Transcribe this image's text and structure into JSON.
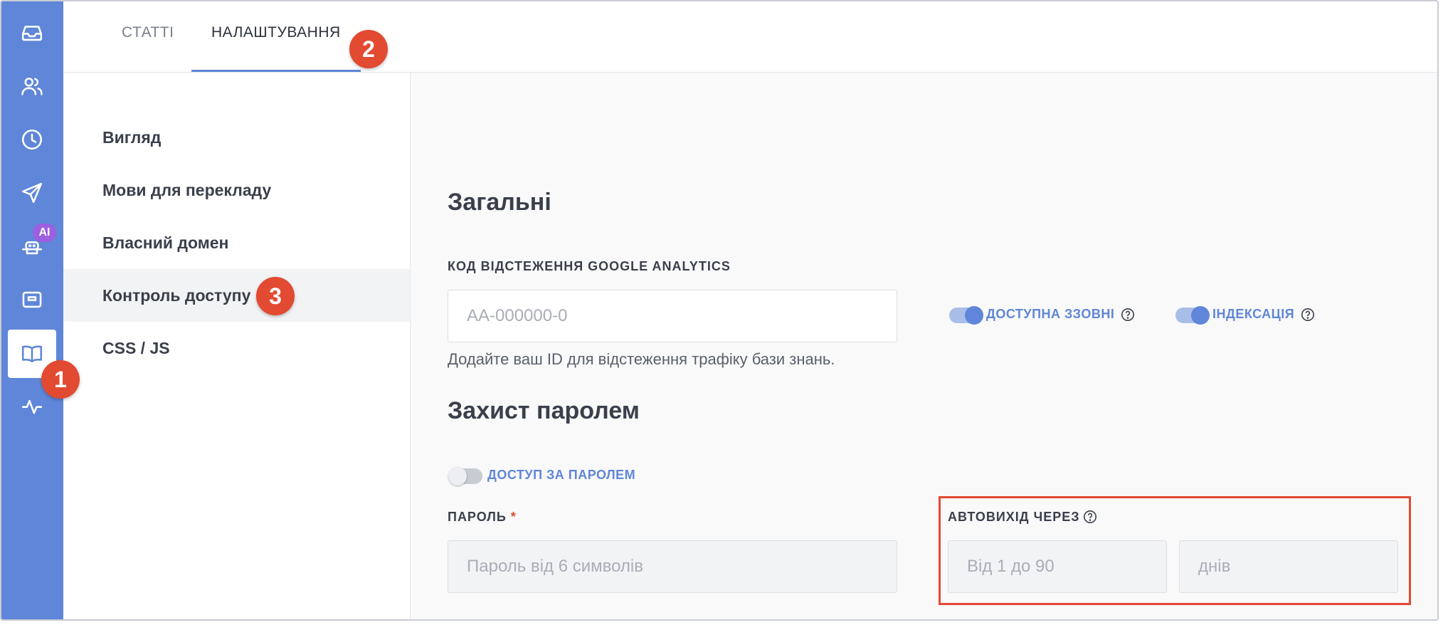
{
  "rail": {
    "items": [
      {
        "icon": "inbox-icon"
      },
      {
        "icon": "users-icon"
      },
      {
        "icon": "clock-icon"
      },
      {
        "icon": "send-icon"
      },
      {
        "icon": "ai-bot-icon",
        "badge": "AI"
      },
      {
        "icon": "widget-icon"
      },
      {
        "icon": "book-icon",
        "active": true
      },
      {
        "icon": "activity-icon"
      }
    ],
    "accent_color": "#5f86d8"
  },
  "steps": [
    "1",
    "2",
    "3"
  ],
  "tabs": [
    {
      "label": "СТАТТІ"
    },
    {
      "label": "НАЛАШТУВАННЯ",
      "active": true
    }
  ],
  "submenu": [
    {
      "label": "Вигляд"
    },
    {
      "label": "Мови для перекладу"
    },
    {
      "label": "Власний домен"
    },
    {
      "label": "Контроль доступу",
      "active": true
    },
    {
      "label": "CSS / JS"
    }
  ],
  "general": {
    "heading": "Загальні",
    "ga_label": "КОД ВІДСТЕЖЕННЯ GOOGLE ANALYTICS",
    "ga_placeholder": "AA-000000-0",
    "ga_hint": "Додайте ваш ID для відстеження трафіку бази знань.",
    "public_toggle": {
      "label": "ДОСТУПНА ЗЗОВНІ",
      "on": true
    },
    "indexing_toggle": {
      "label": "ІНДЕКСАЦІЯ",
      "on": true
    }
  },
  "password": {
    "heading": "Захист паролем",
    "access_toggle": {
      "label": "ДОСТУП ЗА ПАРОЛЕМ",
      "on": false
    },
    "password_label": "ПАРОЛЬ",
    "required_mark": "*",
    "password_placeholder": "Пароль від 6 символів",
    "autologout_label": "АВТОВИХІД ЧЕРЕЗ",
    "autologout_placeholder": "Від 1 до 90",
    "unit_placeholder": "днів"
  },
  "colors": {
    "highlight": "#e24a32",
    "step_marker": "#e24a32",
    "toggle_on": "#5f86d8"
  }
}
